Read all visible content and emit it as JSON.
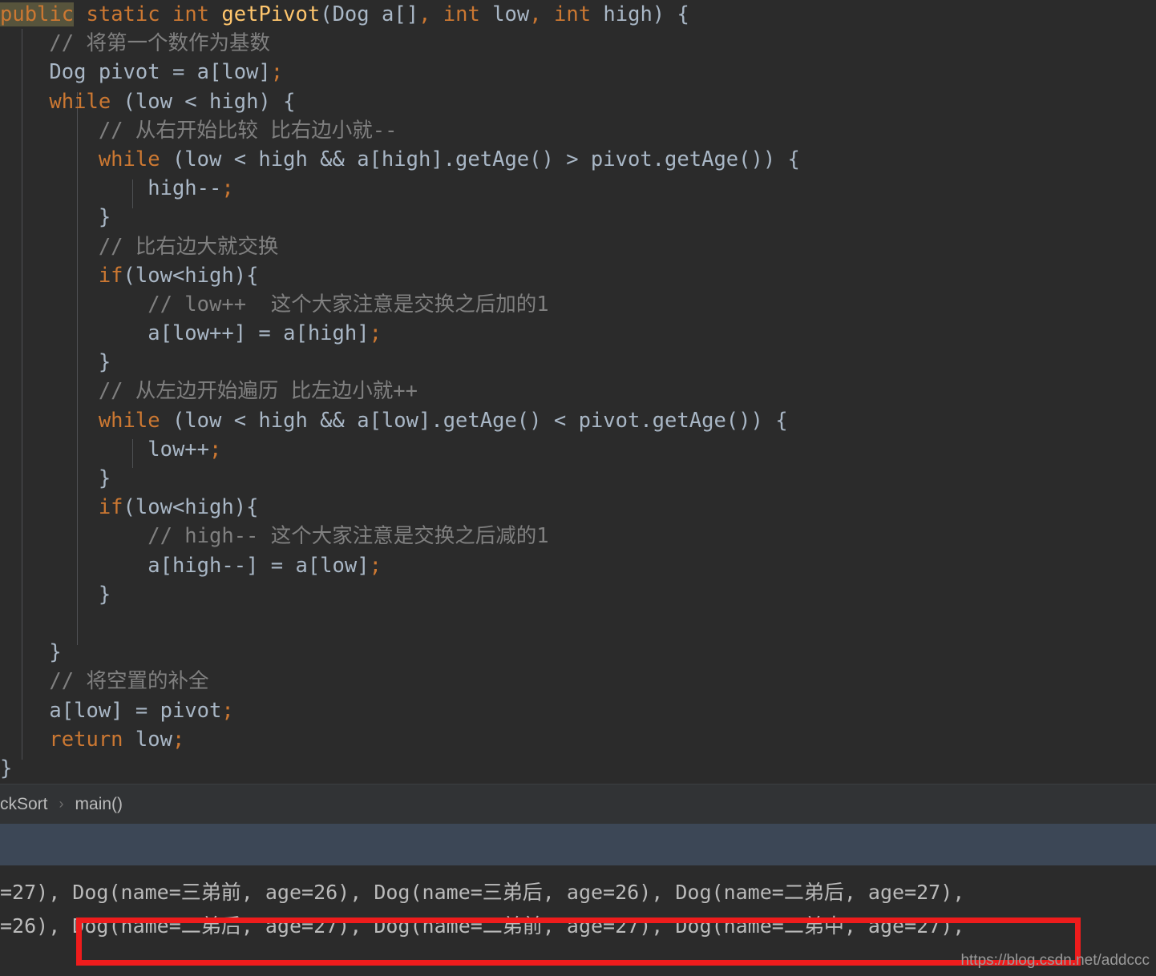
{
  "editor": {
    "language": "java",
    "theme": "darcula",
    "background": "#2b2b2b",
    "colors": {
      "keyword": "#cc7832",
      "identifier": "#a9b7c6",
      "method": "#ffc66d",
      "comment": "#808080",
      "highlight_background": "#57543c",
      "annotation_red": "#ee1c1c",
      "selection_bar": "#3c4756"
    },
    "lines": [
      {
        "id": 1,
        "indent": 0,
        "parts": [
          {
            "t": "public",
            "c": "kw hl"
          },
          {
            "t": " ",
            "c": "txt"
          },
          {
            "t": "static",
            "c": "kw"
          },
          {
            "t": " ",
            "c": "txt"
          },
          {
            "t": "int",
            "c": "kw"
          },
          {
            "t": " ",
            "c": "txt"
          },
          {
            "t": "getPivot",
            "c": "fn"
          },
          {
            "t": "(",
            "c": "txt"
          },
          {
            "t": "Dog",
            "c": "txt"
          },
          {
            "t": " a[]",
            "c": "txt"
          },
          {
            "t": ",",
            "c": "punc"
          },
          {
            "t": " ",
            "c": "txt"
          },
          {
            "t": "int",
            "c": "kw"
          },
          {
            "t": " low",
            "c": "txt"
          },
          {
            "t": ",",
            "c": "punc"
          },
          {
            "t": " ",
            "c": "txt"
          },
          {
            "t": "int",
            "c": "kw"
          },
          {
            "t": " high) {",
            "c": "txt"
          }
        ]
      },
      {
        "id": 2,
        "indent": 1,
        "parts": [
          {
            "t": "// 将第一个数作为基数",
            "c": "cmt"
          }
        ]
      },
      {
        "id": 3,
        "indent": 1,
        "parts": [
          {
            "t": "Dog pivot = a[low]",
            "c": "txt"
          },
          {
            "t": ";",
            "c": "punc"
          }
        ]
      },
      {
        "id": 4,
        "indent": 1,
        "parts": [
          {
            "t": "while",
            "c": "kw"
          },
          {
            "t": " (low < high) {",
            "c": "txt"
          }
        ]
      },
      {
        "id": 5,
        "indent": 2,
        "parts": [
          {
            "t": "// 从右开始比较 比右边小就--",
            "c": "cmt"
          }
        ]
      },
      {
        "id": 6,
        "indent": 2,
        "parts": [
          {
            "t": "while",
            "c": "kw"
          },
          {
            "t": " (low < high && a[high].getAge() > pivot.getAge()) {",
            "c": "txt"
          }
        ]
      },
      {
        "id": 7,
        "indent": 3,
        "parts": [
          {
            "t": "high--",
            "c": "txt"
          },
          {
            "t": ";",
            "c": "punc"
          }
        ]
      },
      {
        "id": 8,
        "indent": 2,
        "parts": [
          {
            "t": "}",
            "c": "txt"
          }
        ]
      },
      {
        "id": 9,
        "indent": 2,
        "parts": [
          {
            "t": "// 比右边大就交换",
            "c": "cmt"
          }
        ]
      },
      {
        "id": 10,
        "indent": 2,
        "parts": [
          {
            "t": "if",
            "c": "kw"
          },
          {
            "t": "(low<high){",
            "c": "txt"
          }
        ]
      },
      {
        "id": 11,
        "indent": 3,
        "parts": [
          {
            "t": "// low++  这个大家注意是交换之后加的1",
            "c": "cmt"
          }
        ]
      },
      {
        "id": 12,
        "indent": 3,
        "parts": [
          {
            "t": "a[low++] = a[high]",
            "c": "txt"
          },
          {
            "t": ";",
            "c": "punc"
          }
        ]
      },
      {
        "id": 13,
        "indent": 2,
        "parts": [
          {
            "t": "}",
            "c": "txt"
          }
        ]
      },
      {
        "id": 14,
        "indent": 2,
        "parts": [
          {
            "t": "// 从左边开始遍历 比左边小就++",
            "c": "cmt"
          }
        ]
      },
      {
        "id": 15,
        "indent": 2,
        "parts": [
          {
            "t": "while",
            "c": "kw"
          },
          {
            "t": " (low < high && a[low].getAge() < pivot.getAge()) {",
            "c": "txt"
          }
        ]
      },
      {
        "id": 16,
        "indent": 3,
        "parts": [
          {
            "t": "low++",
            "c": "txt"
          },
          {
            "t": ";",
            "c": "punc"
          }
        ]
      },
      {
        "id": 17,
        "indent": 2,
        "parts": [
          {
            "t": "}",
            "c": "txt"
          }
        ]
      },
      {
        "id": 18,
        "indent": 2,
        "parts": [
          {
            "t": "if",
            "c": "kw"
          },
          {
            "t": "(low<high){",
            "c": "txt"
          }
        ]
      },
      {
        "id": 19,
        "indent": 3,
        "parts": [
          {
            "t": "// high-- 这个大家注意是交换之后减的1",
            "c": "cmt"
          }
        ]
      },
      {
        "id": 20,
        "indent": 3,
        "parts": [
          {
            "t": "a[high--] = a[low]",
            "c": "txt"
          },
          {
            "t": ";",
            "c": "punc"
          }
        ]
      },
      {
        "id": 21,
        "indent": 2,
        "parts": [
          {
            "t": "}",
            "c": "txt"
          }
        ]
      },
      {
        "id": 22,
        "indent": 0,
        "parts": []
      },
      {
        "id": 23,
        "indent": 1,
        "parts": [
          {
            "t": "}",
            "c": "txt"
          }
        ]
      },
      {
        "id": 24,
        "indent": 1,
        "parts": [
          {
            "t": "// 将空置的补全",
            "c": "cmt"
          }
        ]
      },
      {
        "id": 25,
        "indent": 1,
        "parts": [
          {
            "t": "a[low] = pivot",
            "c": "txt"
          },
          {
            "t": ";",
            "c": "punc"
          }
        ]
      },
      {
        "id": 26,
        "indent": 1,
        "parts": [
          {
            "t": "return",
            "c": "kw"
          },
          {
            "t": " low",
            "c": "txt"
          },
          {
            "t": ";",
            "c": "punc"
          }
        ]
      },
      {
        "id": 27,
        "indent": 0,
        "parts": [
          {
            "t": "}",
            "c": "txt"
          }
        ]
      }
    ]
  },
  "breadcrumb": {
    "class_crumb": "ckSort",
    "separator": "›",
    "method_crumb": "main()"
  },
  "console": {
    "line1": "=27), Dog(name=三弟前, age=26), Dog(name=三弟后, age=26), Dog(name=二弟后, age=27),",
    "line2": "=26), Dog(name=二弟后, age=27), Dog(name=二弟前, age=27), Dog(name=二弟中, age=27),"
  },
  "annotation": {
    "color": "#ee1c1c",
    "shape": "rectangle"
  },
  "watermark": {
    "text": "https://blog.csdn.net/addccc"
  }
}
